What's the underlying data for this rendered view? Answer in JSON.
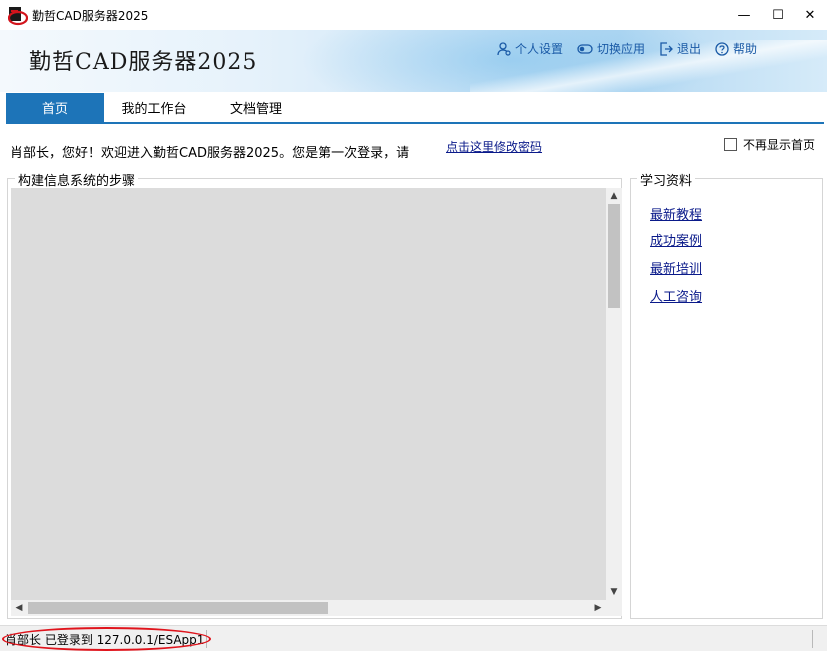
{
  "window": {
    "title": "勤哲CAD服务器2025",
    "minimize": "—",
    "maximize": "☐",
    "close": "✕"
  },
  "banner": {
    "title": "勤哲CAD服务器2025",
    "actions": [
      {
        "label": "个人设置",
        "icon": "user-settings-icon"
      },
      {
        "label": "切换应用",
        "icon": "toggle-icon"
      },
      {
        "label": "退出",
        "icon": "exit-icon"
      },
      {
        "label": "帮助",
        "icon": "help-icon"
      }
    ]
  },
  "tabs": [
    {
      "label": "首页",
      "active": true
    },
    {
      "label": "我的工作台",
      "active": false
    },
    {
      "label": "文档管理",
      "active": false
    }
  ],
  "welcome": {
    "text": "肖部长，您好！欢迎进入勤哲CAD服务器2025。您是第一次登录，请",
    "change_password_link": "点击这里修改密码",
    "no_show_label": "不再显示首页",
    "no_show_checked": false
  },
  "steps_group": {
    "legend": "构建信息系统的步骤"
  },
  "learning_group": {
    "legend": "学习资料",
    "links": [
      "最新教程",
      "成功案例",
      "最新培训",
      "人工咨询"
    ]
  },
  "statusbar": {
    "text": "肖部长 已登录到 127.0.0.1/ESApp1"
  },
  "colors": {
    "accent": "#1d74b8",
    "link": "#0a1a8a",
    "highlight_oval": "#e0141c"
  }
}
